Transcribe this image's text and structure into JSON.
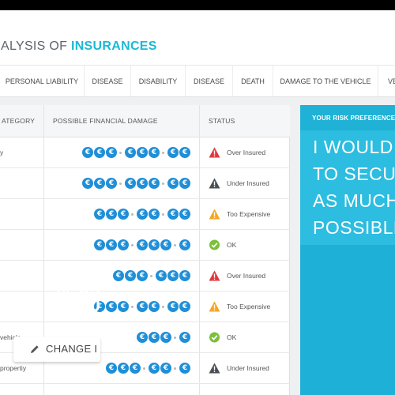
{
  "header": {
    "title_prefix": "ALYSIS OF ",
    "title_accent": "INSURANCES"
  },
  "tabs": [
    "PERSONAL LIABILITY",
    "DISEASE",
    "DISABILITY",
    "DISEASE",
    "DEATH",
    "DAMAGE TO THE VEHICLE",
    "VE"
  ],
  "table": {
    "columns": {
      "category": "ATEGORY",
      "damage": "POSSIBLE FINANCIAL DAMAGE",
      "status": "STATUS"
    },
    "rows": [
      {
        "category": "y",
        "coins": [
          3,
          3,
          2
        ],
        "status": "Over Insured",
        "status_type": "danger"
      },
      {
        "category": "",
        "coins": [
          3,
          3,
          2
        ],
        "status": "Under Insured",
        "status_type": "under"
      },
      {
        "category": "",
        "coins": [
          3,
          2,
          2
        ],
        "status": "Too Expensive",
        "status_type": "warning"
      },
      {
        "category": "",
        "coins": [
          3,
          3,
          1
        ],
        "status": "OK",
        "status_type": "ok"
      },
      {
        "category": "",
        "coins": [
          3,
          3
        ],
        "status": "Over Insured",
        "status_type": "danger"
      },
      {
        "category": "",
        "coins": [
          3,
          2,
          2
        ],
        "status": "Too Expensive",
        "status_type": "warning"
      },
      {
        "category": "vehicle",
        "coins": [
          3,
          1
        ],
        "status": "OK",
        "status_type": "ok"
      },
      {
        "category": "propertiy",
        "coins": [
          3,
          2,
          1
        ],
        "status": "Under Insured",
        "status_type": "under"
      }
    ]
  },
  "coin_symbol": "€",
  "panel": {
    "label": "YOUR RISK PREFERENCES",
    "lines": [
      "I WOULD",
      "TO SECU",
      "AS MUCH",
      "POSSIBLE"
    ],
    "button_label": "CHANGE I"
  },
  "colors": {
    "accent": "#1bb9d6",
    "coin": "#1f8fd8",
    "danger": "#e0383e",
    "warning": "#f5a623",
    "ok": "#7cbf3a",
    "under": "#4a4f55",
    "panel": "#2cbde0"
  }
}
